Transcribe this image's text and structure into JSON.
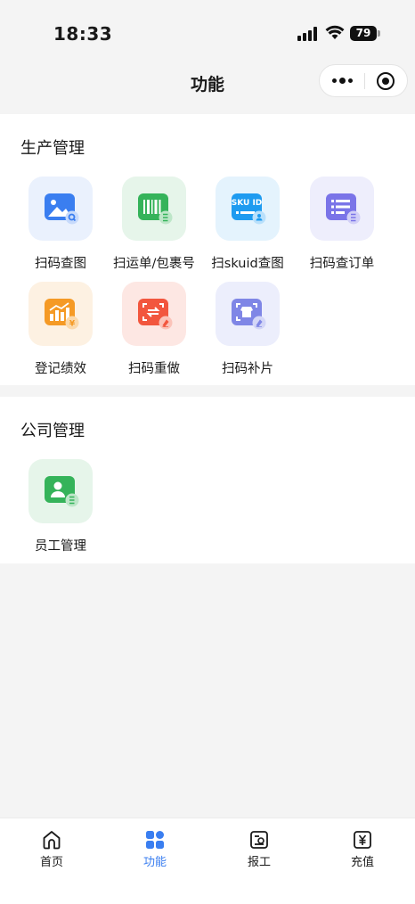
{
  "status_bar": {
    "time": "18:33",
    "battery": "79"
  },
  "nav": {
    "title": "功能"
  },
  "sections": [
    {
      "title": "生产管理",
      "items": [
        {
          "label": "扫码查图",
          "icon": "image-search-icon",
          "badge": "Q"
        },
        {
          "label": "扫运单/包裹号",
          "icon": "barcode-icon",
          "badge": "3"
        },
        {
          "label": "扫skuid查图",
          "icon": "skuid-icon",
          "badge_text": "SKU ID"
        },
        {
          "label": "扫码查订单",
          "icon": "order-list-icon"
        },
        {
          "label": "登记绩效",
          "icon": "performance-chart-icon",
          "badge": "¥"
        },
        {
          "label": "扫码重做",
          "icon": "scan-redo-icon"
        },
        {
          "label": "扫码补片",
          "icon": "scan-patch-icon"
        }
      ]
    },
    {
      "title": "公司管理",
      "items": [
        {
          "label": "员工管理",
          "icon": "employee-card-icon"
        }
      ]
    }
  ],
  "tabbar": {
    "items": [
      {
        "label": "首页",
        "icon": "home-icon",
        "active": false
      },
      {
        "label": "功能",
        "icon": "grid-icon",
        "active": true
      },
      {
        "label": "报工",
        "icon": "report-icon",
        "active": false
      },
      {
        "label": "充值",
        "icon": "yuan-icon",
        "active": false
      }
    ]
  },
  "colors": {
    "accent": "#3a7ef0",
    "background": "#f4f4f4"
  }
}
